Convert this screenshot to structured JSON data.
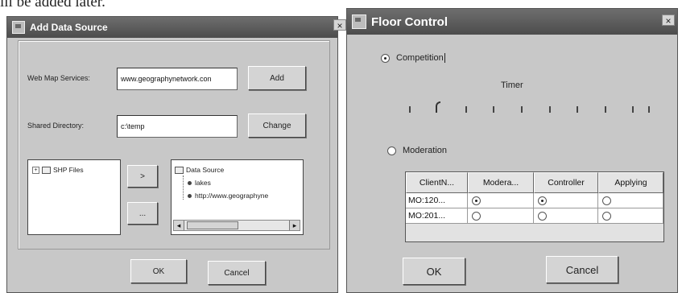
{
  "page_text": "ill be added later.",
  "add_data_source": {
    "title": "Add Data Source",
    "close_glyph": "×",
    "web_map_label": "Web Map Services:",
    "web_map_value": "www.geographynetwork.con",
    "add_label": "Add",
    "shared_dir_label": "Shared Directory:",
    "shared_dir_value": "c:\\temp",
    "change_label": "Change",
    "left_tree_item": "SHP Files",
    "move_right_label": ">",
    "move_left_label": "...",
    "right_tree_root": "Data Source",
    "right_tree_children": [
      "lakes",
      "http://www.geographyne"
    ],
    "scroll_left": "◂",
    "scroll_right": "▸",
    "ok_label": "OK",
    "cancel_label": "Cancel"
  },
  "floor_control": {
    "title": "Floor Control",
    "close_glyph": "×",
    "competition_label": "Competition",
    "timer_label": "Timer",
    "timer_level": 0.1,
    "moderation_label": "Moderation",
    "table": {
      "headers": [
        "ClientN...",
        "Modera...",
        "Controller",
        "Applying"
      ],
      "rows": [
        {
          "client": "MO:120...",
          "moderator": true,
          "controller": true,
          "applying": false
        },
        {
          "client": "MO:201...",
          "moderator": false,
          "controller": false,
          "applying": false
        }
      ]
    },
    "ok_label": "OK",
    "cancel_label": "Cancel"
  }
}
